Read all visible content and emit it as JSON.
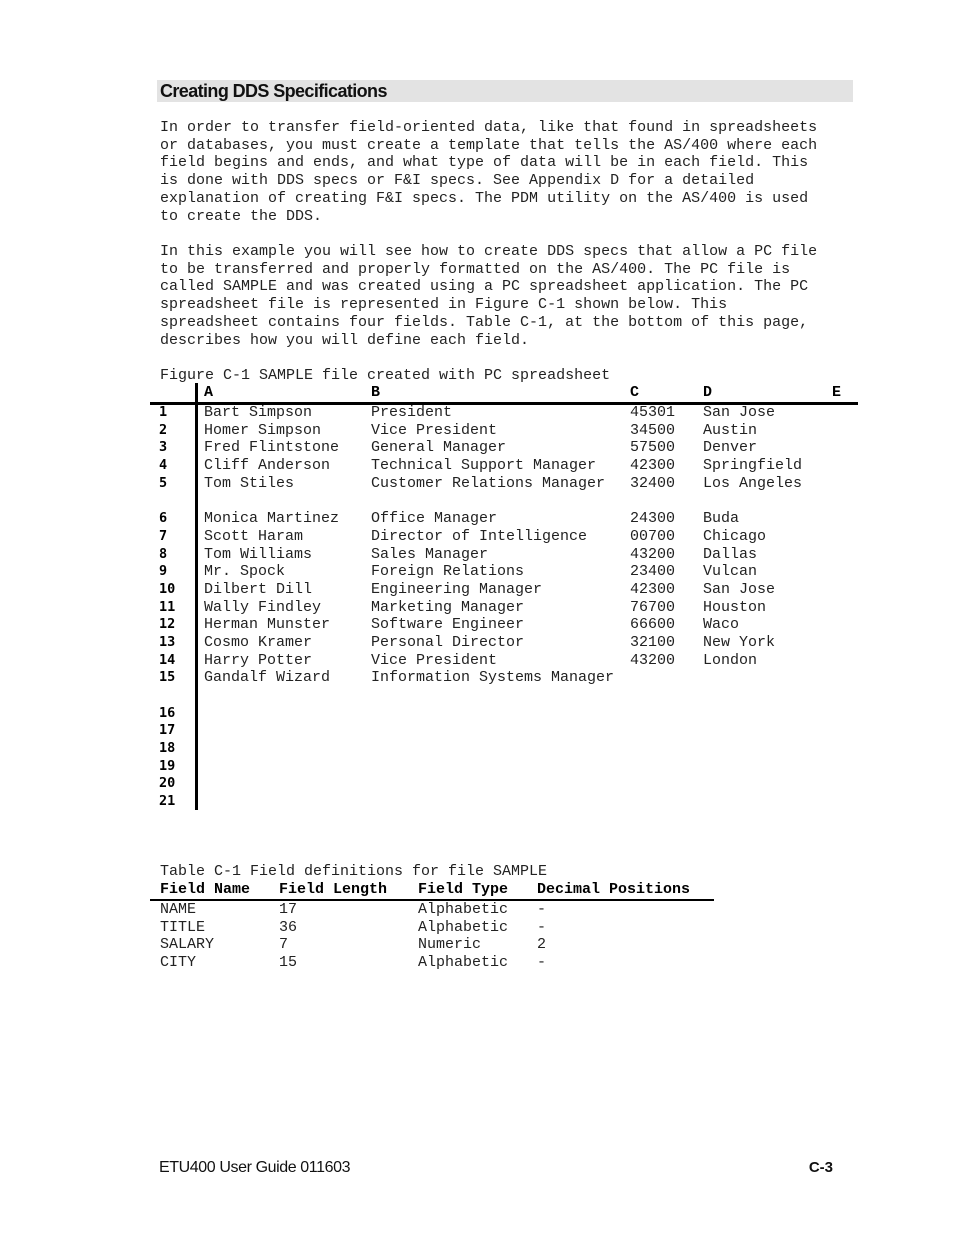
{
  "section": {
    "title": "Creating DDS Specifications"
  },
  "paragraphs": [
    "In order to transfer field-oriented data, like that found in spreadsheets\nor databases, you must create a template that tells the AS/400 where each\nfield begins and ends, and what type of data will be in each field. This\nis done with DDS specs or F&I specs. See Appendix D for a detailed\nexplanation of creating F&I specs. The PDM utility on the AS/400 is used\nto create the DDS.",
    "In this example you will see how to create DDS specs that allow a PC file\nto be transferred and properly formatted on the AS/400. The PC file is\ncalled SAMPLE and was created using a PC spreadsheet application. The PC\nspreadsheet file is represented in Figure C-1 shown below. This\nspreadsheet contains four fields. Table C-1, at the bottom of this page,\ndescribes how you will define each field."
  ],
  "figure": {
    "caption": "Figure C-1 SAMPLE file created with PC spreadsheet",
    "columns": [
      "A",
      "B",
      "C",
      "D",
      "E"
    ],
    "rows": [
      {
        "num": "1",
        "name": "Bart Simpson",
        "title": "President",
        "salary": "45301",
        "city": "San Jose"
      },
      {
        "num": "2",
        "name": "Homer Simpson",
        "title": "Vice President",
        "salary": "34500",
        "city": "Austin"
      },
      {
        "num": "3",
        "name": "Fred Flintstone",
        "title": "General Manager",
        "salary": "57500",
        "city": "Denver"
      },
      {
        "num": "4",
        "name": "Cliff Anderson",
        "title": "Technical Support Manager",
        "salary": "42300",
        "city": "Springfield"
      },
      {
        "num": "5",
        "name": "Tom Stiles",
        "title": "Customer Relations Manager",
        "salary": "32400",
        "city": "Los Angeles"
      },
      {
        "num": "6",
        "name": "Monica Martinez",
        "title": "Office Manager",
        "salary": "24300",
        "city": "Buda"
      },
      {
        "num": "7",
        "name": "Scott Haram",
        "title": "Director of Intelligence",
        "salary": "00700",
        "city": "Chicago"
      },
      {
        "num": "8",
        "name": "Tom Williams",
        "title": "Sales Manager",
        "salary": "43200",
        "city": "Dallas"
      },
      {
        "num": "9",
        "name": "Mr. Spock",
        "title": "Foreign Relations",
        "salary": "23400",
        "city": "Vulcan"
      },
      {
        "num": "10",
        "name": "Dilbert Dill",
        "title": "Engineering Manager",
        "salary": "42300",
        "city": "San Jose"
      },
      {
        "num": "11",
        "name": "Wally Findley",
        "title": "Marketing Manager",
        "salary": "76700",
        "city": "Houston"
      },
      {
        "num": "12",
        "name": "Herman Munster",
        "title": "Software Engineer",
        "salary": "66600",
        "city": "Waco"
      },
      {
        "num": "13",
        "name": "Cosmo Kramer",
        "title": "Personal Director",
        "salary": "32100",
        "city": "New York"
      },
      {
        "num": "14",
        "name": "Harry Potter",
        "title": "Vice President",
        "salary": "43200",
        "city": "London"
      },
      {
        "num": "15",
        "name": "Gandalf Wizard",
        "title": "Information Systems Manager",
        "salary": "",
        "city": ""
      },
      {
        "num": "16",
        "name": "",
        "title": "",
        "salary": "",
        "city": ""
      },
      {
        "num": "17",
        "name": "",
        "title": "",
        "salary": "",
        "city": ""
      },
      {
        "num": "18",
        "name": "",
        "title": "",
        "salary": "",
        "city": ""
      },
      {
        "num": "19",
        "name": "",
        "title": "",
        "salary": "",
        "city": ""
      },
      {
        "num": "20",
        "name": "",
        "title": "",
        "salary": "",
        "city": ""
      },
      {
        "num": "21",
        "name": "",
        "title": "",
        "salary": "",
        "city": ""
      }
    ]
  },
  "table": {
    "caption": "Table C-1 Field definitions for file SAMPLE",
    "headers": [
      "Field Name",
      "Field Length",
      "Field Type",
      "Decimal Positions"
    ],
    "rows": [
      [
        "NAME",
        "17",
        "Alphabetic",
        "-"
      ],
      [
        "TITLE",
        "36",
        "Alphabetic",
        "-"
      ],
      [
        "SALARY",
        "7",
        "Numeric",
        "2"
      ],
      [
        "CITY",
        "15",
        "Alphabetic",
        "-"
      ]
    ]
  },
  "footer": {
    "left": "ETU400 User Guide 011603",
    "right": "C-3"
  }
}
